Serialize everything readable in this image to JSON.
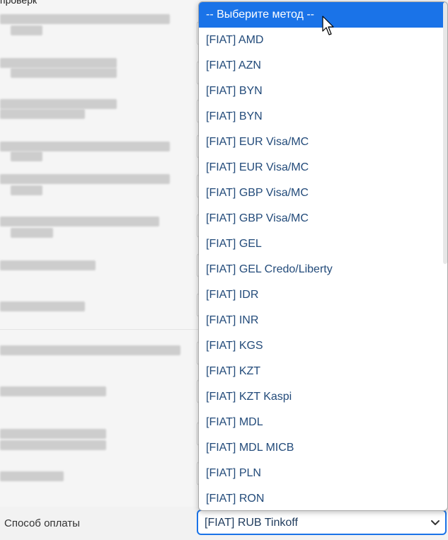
{
  "top_label": "проверк",
  "dropdown": {
    "options": [
      {
        "label": "-- Выберите метод --",
        "selected": true
      },
      {
        "label": "[FIAT] AMD"
      },
      {
        "label": "[FIAT] AZN"
      },
      {
        "label": "[FIAT] BYN"
      },
      {
        "label": "[FIAT] BYN"
      },
      {
        "label": "[FIAT] EUR Visa/MC"
      },
      {
        "label": "[FIAT] EUR Visa/MC"
      },
      {
        "label": "[FIAT] GBP Visa/MC"
      },
      {
        "label": "[FIAT] GBP Visa/MC"
      },
      {
        "label": "[FIAT] GEL"
      },
      {
        "label": "[FIAT] GEL Credo/Liberty"
      },
      {
        "label": "[FIAT] IDR"
      },
      {
        "label": "[FIAT] INR"
      },
      {
        "label": "[FIAT] KGS"
      },
      {
        "label": "[FIAT] KZT"
      },
      {
        "label": "[FIAT] KZT Kaspi"
      },
      {
        "label": "[FIAT] MDL"
      },
      {
        "label": "[FIAT] MDL MICB"
      },
      {
        "label": "[FIAT] PLN"
      },
      {
        "label": "[FIAT] RON"
      }
    ]
  },
  "payment": {
    "label": "Способ оплаты",
    "value": "[FIAT] RUB Tinkoff",
    "chevron_icon": "chevron-down-icon"
  },
  "colors": {
    "selected_bg": "#1a73e8",
    "option_text": "#234b7a",
    "focus_border": "#1a73e8"
  }
}
